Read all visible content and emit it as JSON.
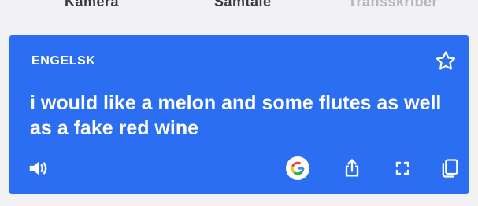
{
  "top_tabs": [
    {
      "label": "Kamera"
    },
    {
      "label": "Samtale"
    },
    {
      "label": "Transskriber"
    }
  ],
  "card": {
    "language": "ENGELSK",
    "translation": "i would like a melon and some flutes as well as a fake red wine",
    "background_color": "#2b6ef2"
  },
  "icons": {
    "star": "star-icon",
    "speaker": "speaker-icon",
    "google": "google-icon",
    "share": "share-icon",
    "fullscreen": "fullscreen-icon",
    "copy": "copy-icon"
  }
}
